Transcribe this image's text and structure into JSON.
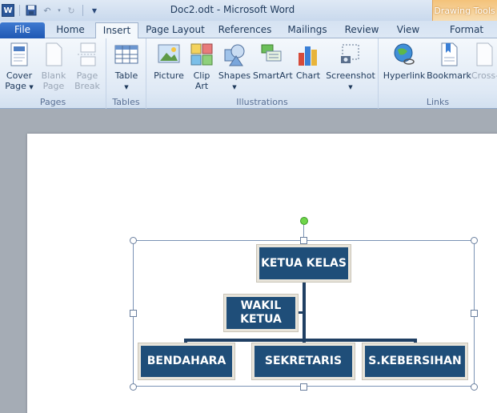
{
  "window": {
    "title": "Doc2.odt  -  Microsoft Word",
    "app_icon": "W"
  },
  "context_group": {
    "label": "Drawing Tools"
  },
  "tabs": [
    {
      "label": "File"
    },
    {
      "label": "Home"
    },
    {
      "label": "Insert"
    },
    {
      "label": "Page Layout"
    },
    {
      "label": "References"
    },
    {
      "label": "Mailings"
    },
    {
      "label": "Review"
    },
    {
      "label": "View"
    },
    {
      "label": "Format"
    }
  ],
  "ribbon": {
    "groups": {
      "pages": "Pages",
      "tables": "Tables",
      "illustrations": "Illustrations",
      "links": "Links"
    },
    "buttons": {
      "cover_page": "Cover Page",
      "blank_page": "Blank Page",
      "page_break": "Page Break",
      "table": "Table",
      "picture": "Picture",
      "clip_art": "Clip Art",
      "shapes": "Shapes",
      "smartart": "SmartArt",
      "chart": "Chart",
      "screenshot": "Screenshot",
      "hyperlink": "Hyperlink",
      "bookmark": "Bookmark",
      "cross_ref": "Cross-"
    }
  },
  "org_chart": {
    "top": "KETUA KELAS",
    "assistant": "WAKIL KETUA",
    "children": [
      "BENDAHARA",
      "SEKRETARIS",
      "S.KEBERSIHAN"
    ]
  },
  "colors": {
    "node_fill": "#1f4e79",
    "accent": "#2b579a",
    "context_tab": "#f4c27a"
  }
}
